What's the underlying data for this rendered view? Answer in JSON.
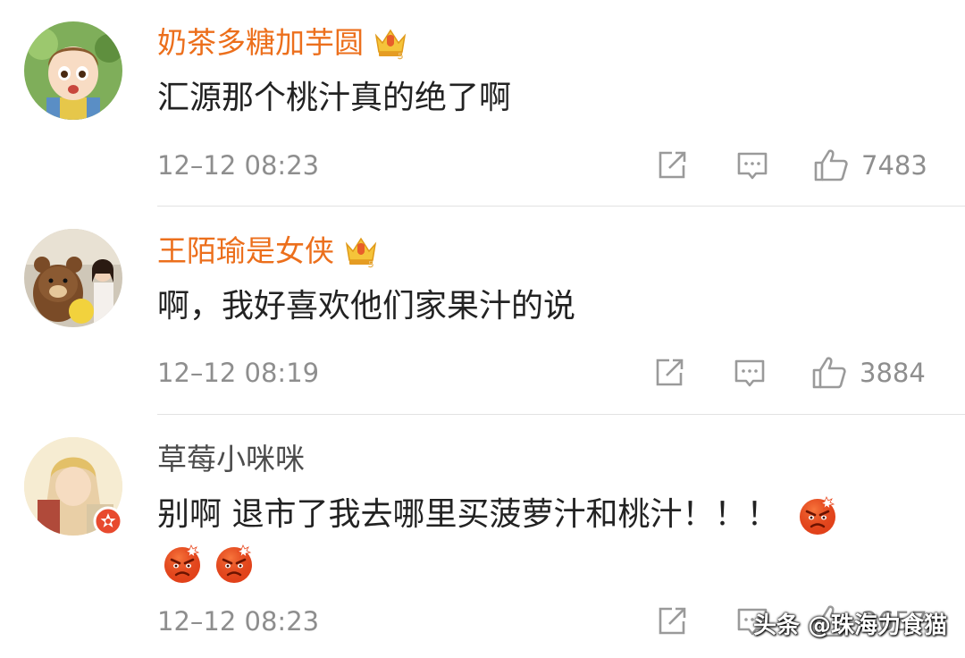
{
  "colors": {
    "vip_name": "#ec6f1c",
    "normal_name": "#4c4c4c",
    "meta": "#8e8e8e",
    "text": "#222222"
  },
  "comments": [
    {
      "username": "奶茶多糖加芋圆",
      "vip_badge": "crown-vip-icon",
      "text": "汇源那个桃汁真的绝了啊",
      "time": "12–12 08:23",
      "likes": "7483"
    },
    {
      "username": "王陌瑜是女侠",
      "vip_badge": "crown-vip-icon",
      "text": "啊，我好喜欢他们家果汁的说",
      "time": "12–12 08:19",
      "likes": "3884"
    },
    {
      "username": "草莓小咪咪",
      "verified_badge": "star-badge-icon",
      "text": "别啊 退市了我去哪里买菠萝汁和桃汁！！！",
      "emojis": [
        "angry-emoji",
        "angry-emoji",
        "angry-emoji"
      ],
      "time": "12–12 08:23",
      "likes": "2657"
    }
  ],
  "icons": {
    "share": "share-icon",
    "reply": "comment-icon",
    "like": "thumbs-up-icon"
  },
  "watermark": "头条 @珠海力食猫"
}
